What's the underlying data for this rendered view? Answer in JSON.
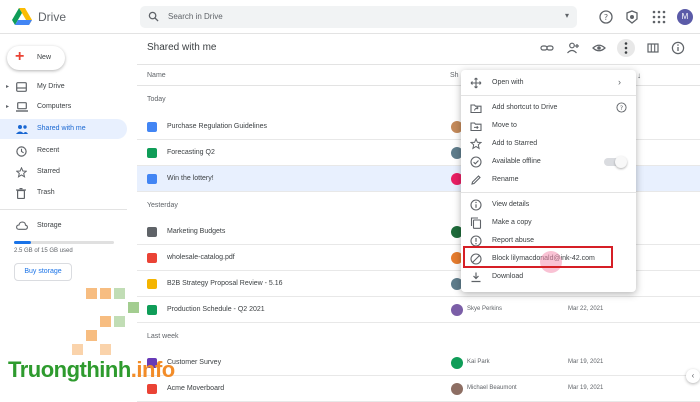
{
  "app": {
    "title": "Drive"
  },
  "search": {
    "placeholder": "Search in Drive"
  },
  "account": {
    "initial": "M"
  },
  "sidebar": {
    "new_label": "New",
    "items": [
      {
        "label": "My Drive",
        "icon": "my-drive-icon"
      },
      {
        "label": "Computers",
        "icon": "computer-icon"
      },
      {
        "label": "Shared with me",
        "icon": "shared-icon"
      },
      {
        "label": "Recent",
        "icon": "clock-icon"
      },
      {
        "label": "Starred",
        "icon": "star-icon"
      },
      {
        "label": "Trash",
        "icon": "trash-icon"
      }
    ],
    "storage": {
      "label": "Storage",
      "usage": "2.5 GB of 15 GB used",
      "fraction": 0.17,
      "buy_label": "Buy storage"
    }
  },
  "main": {
    "title": "Shared with me",
    "columns": {
      "name": "Name",
      "shared_by": "Sh",
      "sort": "↓"
    },
    "sections": [
      "Today",
      "Yesterday",
      "Last week"
    ],
    "files": [
      {
        "name": "Purchase Regulation Guidelines",
        "type": "doc",
        "color": "#4285f4",
        "owner": "",
        "date": "",
        "avatar": "#c48a5a"
      },
      {
        "name": "Forecasting Q2",
        "type": "sheet",
        "color": "#0f9d58",
        "owner": "",
        "date": "",
        "avatar": "#5f7d8c"
      },
      {
        "name": "Win the lottery!",
        "type": "doc",
        "color": "#4285f4",
        "owner": "",
        "date": "",
        "avatar": "#e91e63"
      },
      {
        "name": "Marketing Budgets",
        "type": "folder",
        "color": "#5f6368",
        "owner": "",
        "date": "",
        "avatar": "#1e6b3a"
      },
      {
        "name": "wholesale-catalog.pdf",
        "type": "pdf",
        "color": "#ea4335",
        "owner": "",
        "date": "",
        "avatar": "#e67c2e"
      },
      {
        "name": "B2B Strategy Proposal Review - 5.16",
        "type": "slides",
        "color": "#f4b400",
        "owner": "",
        "date": "",
        "avatar": "#5f7d8c"
      },
      {
        "name": "Production Schedule - Q2 2021",
        "type": "sheet",
        "color": "#0f9d58",
        "owner": "Skye Perkins",
        "date": "Mar 22, 2021",
        "avatar": "#7b5ea7"
      },
      {
        "name": "Customer Survey",
        "type": "form",
        "color": "#673ab7",
        "owner": "Kai Park",
        "date": "Mar 19, 2021",
        "avatar": "#0f9d58"
      },
      {
        "name": "Acme Moverboard",
        "type": "slides",
        "color": "#ea4335",
        "owner": "Michael Beaumont",
        "date": "Mar 19, 2021",
        "avatar": "#8d6e63"
      }
    ]
  },
  "context_menu": {
    "items": [
      {
        "label": "Open with",
        "icon": "move-icon"
      },
      {
        "label": "Add shortcut to Drive",
        "icon": "shortcut-icon"
      },
      {
        "label": "Move to",
        "icon": "folder-move-icon"
      },
      {
        "label": "Add to Starred",
        "icon": "star-icon"
      },
      {
        "label": "Available offline",
        "icon": "offline-icon"
      },
      {
        "label": "Rename",
        "icon": "pencil-icon"
      },
      {
        "label": "View details",
        "icon": "info-icon"
      },
      {
        "label": "Make a copy",
        "icon": "copy-icon"
      },
      {
        "label": "Report abuse",
        "icon": "report-icon"
      },
      {
        "label": "Block lilymacdonald@ink-42.com",
        "icon": "block-icon"
      },
      {
        "label": "Download",
        "icon": "download-icon"
      }
    ]
  },
  "watermark": {
    "main": "Truongthinh",
    "suffix": ".info"
  },
  "colors": {
    "accent": "#1a73e8",
    "highlight": "#d61f26",
    "selected_row": "#e8f0fe"
  }
}
